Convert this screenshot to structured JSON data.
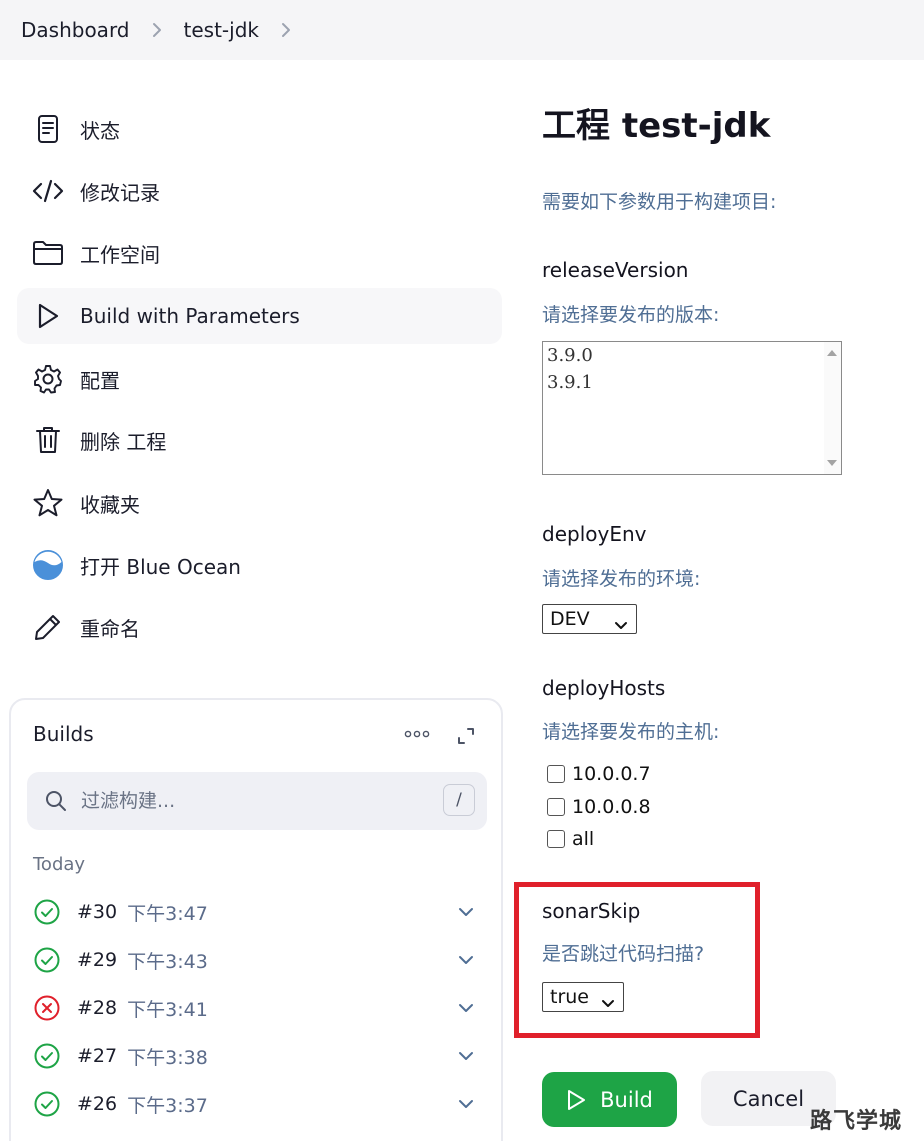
{
  "breadcrumb": {
    "items": [
      "Dashboard",
      "test-jdk"
    ]
  },
  "sidebar": {
    "items": [
      {
        "label": "状态",
        "icon": "document-icon"
      },
      {
        "label": "修改记录",
        "icon": "code-icon"
      },
      {
        "label": "工作空间",
        "icon": "folder-icon"
      },
      {
        "label": "Build with Parameters",
        "icon": "play-icon",
        "active": true
      },
      {
        "label": "配置",
        "icon": "gear-icon"
      },
      {
        "label": "删除 工程",
        "icon": "trash-icon"
      },
      {
        "label": "收藏夹",
        "icon": "star-icon"
      },
      {
        "label": "打开 Blue Ocean",
        "icon": "blue-ocean-icon"
      },
      {
        "label": "重命名",
        "icon": "pencil-icon"
      }
    ]
  },
  "builds": {
    "title": "Builds",
    "filter_placeholder": "过滤构建...",
    "filter_shortcut": "/",
    "group": "Today",
    "rows": [
      {
        "number": "#30",
        "time": "下午3:47",
        "status": "success"
      },
      {
        "number": "#29",
        "time": "下午3:43",
        "status": "success"
      },
      {
        "number": "#28",
        "time": "下午3:41",
        "status": "failed"
      },
      {
        "number": "#27",
        "time": "下午3:38",
        "status": "success"
      },
      {
        "number": "#26",
        "time": "下午3:37",
        "status": "success"
      }
    ]
  },
  "main": {
    "title": "工程 test-jdk",
    "description": "需要如下参数用于构建项目:",
    "params": {
      "releaseVersion": {
        "name": "releaseVersion",
        "description": "请选择要发布的版本:",
        "options": [
          "3.9.0",
          "3.9.1"
        ]
      },
      "deployEnv": {
        "name": "deployEnv",
        "description": "请选择发布的环境:",
        "value": "DEV"
      },
      "deployHosts": {
        "name": "deployHosts",
        "description": "请选择要发布的主机:",
        "options": [
          "10.0.0.7",
          "10.0.0.8",
          "all"
        ]
      },
      "sonarSkip": {
        "name": "sonarSkip",
        "description": "是否跳过代码扫描?",
        "value": "true"
      }
    },
    "build_label": "Build",
    "cancel_label": "Cancel"
  },
  "watermark": "路飞学城",
  "colors": {
    "build_button": "#1ea446",
    "success": "#1ea446",
    "failed": "#e0202b",
    "highlight": "#e0202b",
    "desc_text": "#4f6e94"
  }
}
